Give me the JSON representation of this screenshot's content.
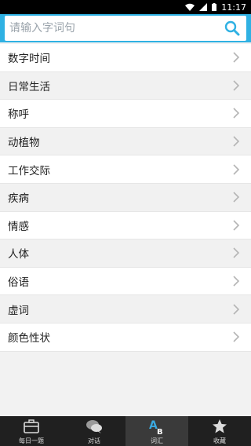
{
  "status": {
    "time": "11:17"
  },
  "search": {
    "placeholder": "请输入字词句"
  },
  "categories": [
    "数字时间",
    "日常生活",
    "称呼",
    "动植物",
    "工作交际",
    "疾病",
    "情感",
    "人体",
    "俗语",
    "虚词",
    "颜色性状"
  ],
  "nav": [
    {
      "label": "每日一题",
      "icon": "briefcase-icon"
    },
    {
      "label": "对话",
      "icon": "chat-bubbles-icon"
    },
    {
      "label": "词汇",
      "icon": "ab-letters-icon"
    },
    {
      "label": "收藏",
      "icon": "star-icon"
    }
  ],
  "colors": {
    "accent": "#2fb1e3",
    "navbar": "#202020"
  }
}
